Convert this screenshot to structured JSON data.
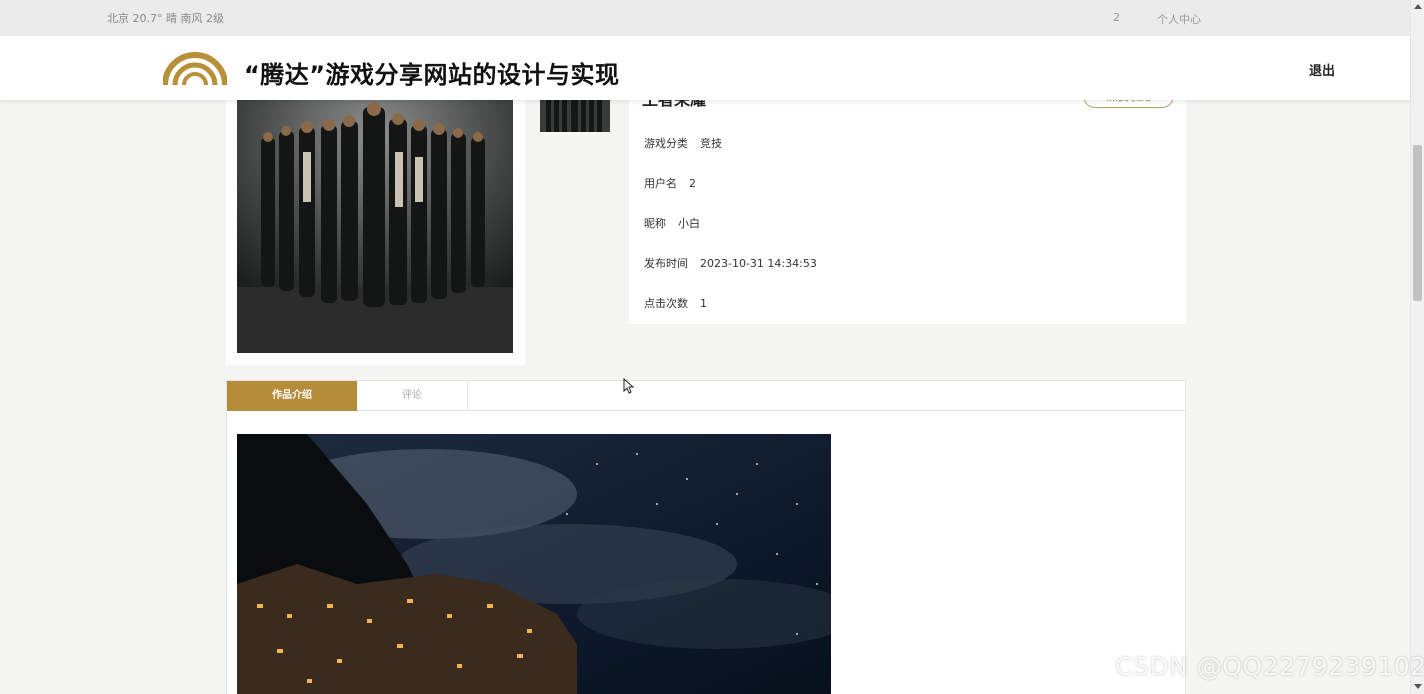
{
  "topbar": {
    "weather": "北京  20.7°  晴  南风  2级",
    "username": "2",
    "personal_center": "个人中心"
  },
  "header": {
    "site_title": "“腾达”游戏分享网站的设计与实现",
    "logout": "退出"
  },
  "colors": {
    "accent": "#b58d3a",
    "logo_gold": "#b8903a",
    "page_bg": "#f4f4f2"
  },
  "detail": {
    "title": "王者荣耀",
    "collect_button": "点我收藏",
    "fields": [
      {
        "label": "游戏分类",
        "value": "竞技"
      },
      {
        "label": "用户名",
        "value": "2"
      },
      {
        "label": "昵称",
        "value": "小白"
      },
      {
        "label": "发布时间",
        "value": "2023-10-31 14:34:53"
      },
      {
        "label": "点击次数",
        "value": "1"
      }
    ]
  },
  "tabs": [
    {
      "label": "作品介绍",
      "active": true
    },
    {
      "label": "评论",
      "active": false
    }
  ],
  "watermark": "CSDN @QQ2279239102"
}
